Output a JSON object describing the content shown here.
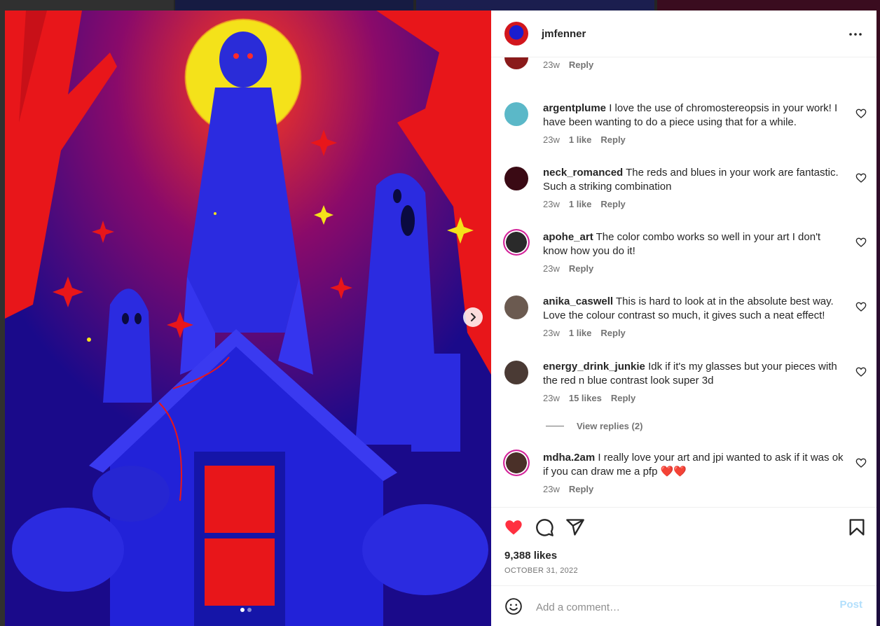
{
  "post": {
    "author": "jmfenner",
    "likes": "9,388 likes",
    "date": "OCTOBER 31, 2022"
  },
  "partial_comment": {
    "time": "23w",
    "reply": "Reply"
  },
  "comments": [
    {
      "user": "argentplume",
      "text": "I love the use of chromostereopsis in your work! I have been wanting to do a piece using that for a while.",
      "time": "23w",
      "likes": "1 like",
      "reply": "Reply"
    },
    {
      "user": "neck_romanced",
      "text": "The reds and blues in your work are fantastic. Such a striking combination",
      "time": "23w",
      "likes": "1 like",
      "reply": "Reply"
    },
    {
      "user": "apohe_art",
      "text": "The color combo works so well in your art I don't know how you do it!",
      "time": "23w",
      "likes": "",
      "reply": "Reply"
    },
    {
      "user": "anika_caswell",
      "text": "This is hard to look at in the absolute best way. Love the colour contrast so much, it gives such a neat effect!",
      "time": "23w",
      "likes": "1 like",
      "reply": "Reply"
    },
    {
      "user": "energy_drink_junkie",
      "text": "Idk if it's my glasses but your pieces with the red n blue contrast look super 3d",
      "time": "23w",
      "likes": "15 likes",
      "reply": "Reply"
    },
    {
      "user": "mdha.2am",
      "text": "I really love your art and jpi wanted to ask if it was ok if you can draw me a pfp ❤️❤️",
      "time": "23w",
      "likes": "",
      "reply": "Reply"
    }
  ],
  "view_replies": "View replies (2)",
  "add_comment": {
    "placeholder": "Add a comment…",
    "post_label": "Post"
  },
  "colors": {
    "like_red": "#ff3040",
    "post_blue": "#b2dffc",
    "muted": "#737373"
  },
  "icons": [
    "heart-filled-icon",
    "comment-icon",
    "share-icon",
    "bookmark-icon",
    "emoji-icon",
    "more-icon",
    "chevron-right-icon",
    "heart-outline-icon"
  ]
}
